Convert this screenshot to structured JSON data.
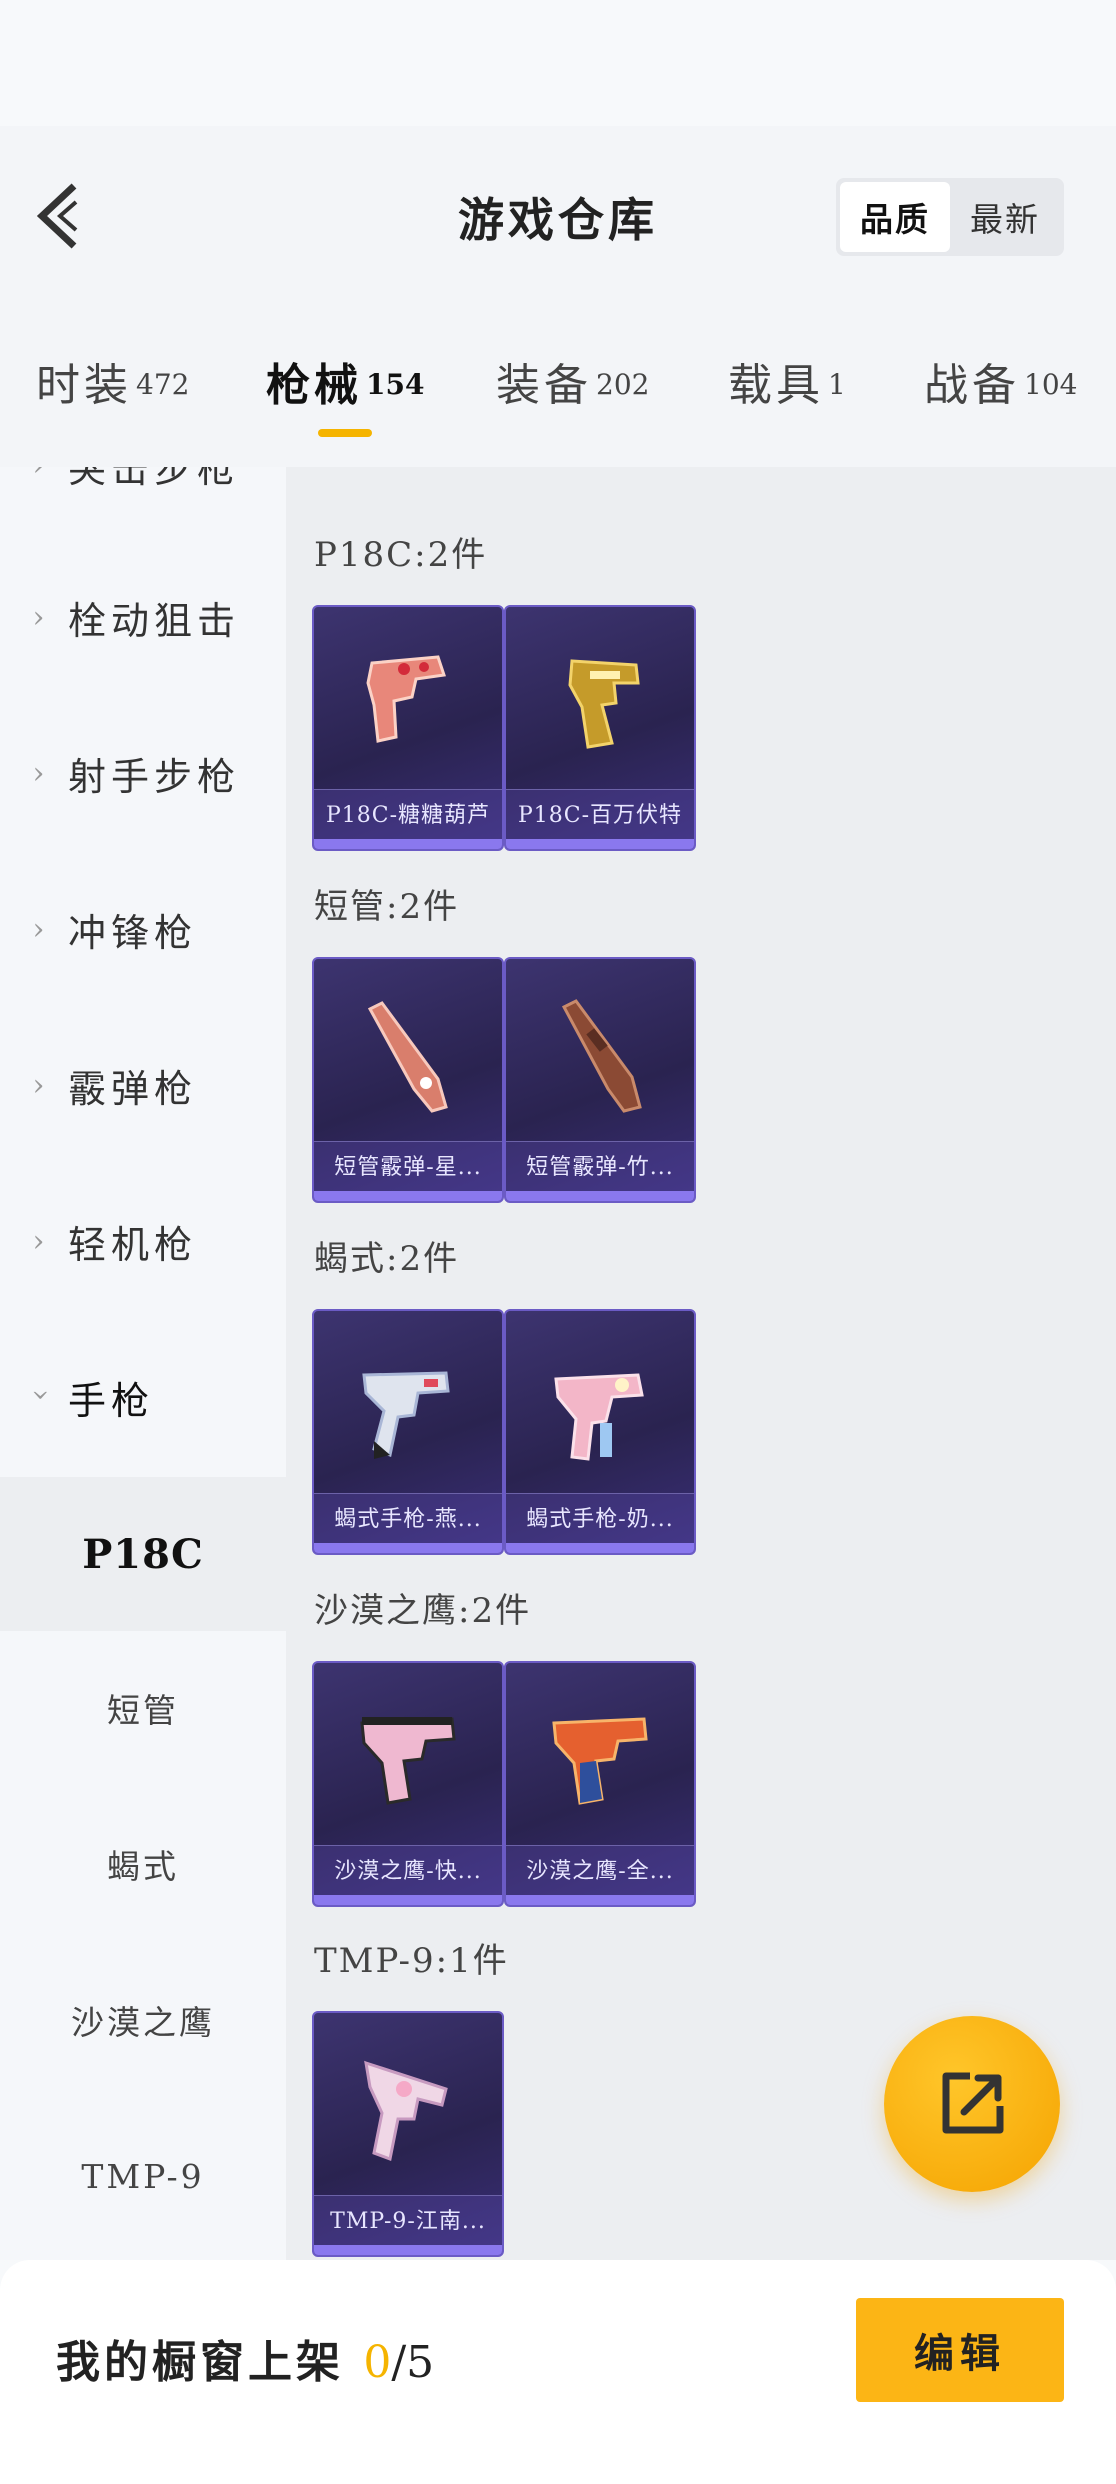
{
  "header": {
    "title": "游戏仓库"
  },
  "sort": {
    "quality": "品质",
    "latest": "最新"
  },
  "tabs": [
    {
      "label": "时装",
      "count": "472"
    },
    {
      "label": "枪械",
      "count": "154"
    },
    {
      "label": "装备",
      "count": "202"
    },
    {
      "label": "载具",
      "count": "1"
    },
    {
      "label": "战备",
      "count": "104"
    }
  ],
  "sidebar": {
    "partial": "突击步枪",
    "categories": [
      "栓动狙击",
      "射手步枪",
      "冲锋枪",
      "霰弹枪",
      "轻机枪",
      "手枪"
    ],
    "subs": [
      "P18C",
      "短管",
      "蝎式",
      "沙漠之鹰",
      "TMP-9"
    ]
  },
  "groups": [
    {
      "title": "P18C:2件",
      "items": [
        "P18C-糖糖葫芦",
        "P18C-百万伏特"
      ]
    },
    {
      "title": "短管:2件",
      "items": [
        "短管霰弹-星...",
        "短管霰弹-竹..."
      ]
    },
    {
      "title": "蝎式:2件",
      "items": [
        "蝎式手枪-燕...",
        "蝎式手枪-奶..."
      ]
    },
    {
      "title": "沙漠之鹰:2件",
      "items": [
        "沙漠之鹰-快...",
        "沙漠之鹰-全..."
      ]
    },
    {
      "title": "TMP-9:1件",
      "items": [
        "TMP-9-江南..."
      ]
    }
  ],
  "footer": {
    "shelf_label": "我的橱窗上架",
    "shelf_count": "0",
    "shelf_total": "/5",
    "edit_label": "编辑"
  },
  "colors": {
    "accent": "#f5b400",
    "card_border": "#6b5bc5",
    "card_bg": "#2a2350"
  },
  "icons": {
    "back": "chevron-left-icon",
    "fab": "share-external-icon"
  }
}
